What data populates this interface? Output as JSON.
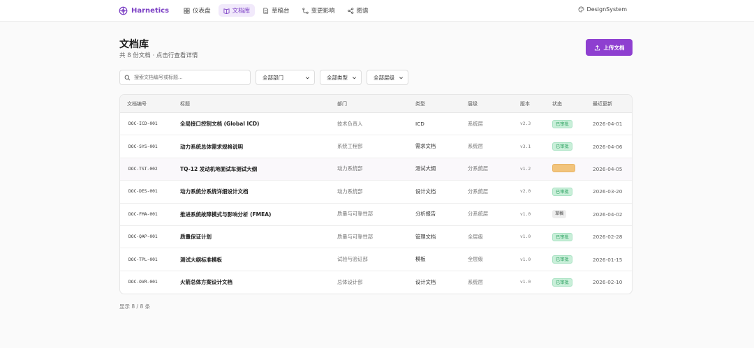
{
  "brand": {
    "name": "Harnetics"
  },
  "nav": [
    {
      "label": "仪表盘",
      "icon": "dashboard-icon",
      "active": false
    },
    {
      "label": "文档库",
      "icon": "book-icon",
      "active": true
    },
    {
      "label": "草稿台",
      "icon": "draft-icon",
      "active": false
    },
    {
      "label": "变更影响",
      "icon": "impact-icon",
      "active": false
    },
    {
      "label": "图谱",
      "icon": "graph-icon",
      "active": false
    }
  ],
  "design_system": {
    "label": "DesignSystem"
  },
  "page": {
    "title": "文档库",
    "subtitle": "共 8 份文档 · 点击行查看详情",
    "upload_label": "上传文档"
  },
  "filters": {
    "search_placeholder": "搜索文档编号或标题...",
    "department": "全部部门",
    "type": "全部类型",
    "level": "全部层级"
  },
  "table": {
    "headers": [
      "文档编号",
      "标题",
      "部门",
      "类型",
      "层级",
      "版本",
      "状态",
      "最近更新"
    ],
    "rows": [
      {
        "id": "DOC-ICD-001",
        "title": "全局接口控制文档 (Global ICD)",
        "dept": "技术负责人",
        "type": "ICD",
        "level": "系统层",
        "version": "v2.3",
        "status": "已审批",
        "status_kind": "green",
        "updated": "2026-04-01"
      },
      {
        "id": "DOC-SYS-001",
        "title": "动力系统总体需求规格说明",
        "dept": "系统工程部",
        "type": "需求文档",
        "level": "系统层",
        "version": "v3.1",
        "status": "已审批",
        "status_kind": "green",
        "updated": "2026-04-06"
      },
      {
        "id": "DOC-TST-002",
        "title": "TQ-12 发动机地面试车测试大纲",
        "dept": "动力系统部",
        "type": "测试大纲",
        "level": "分系统层",
        "version": "v1.2",
        "status": "",
        "status_kind": "orange",
        "updated": "2026-04-05"
      },
      {
        "id": "DOC-DES-001",
        "title": "动力系统分系统详细设计文档",
        "dept": "动力系统部",
        "type": "设计文档",
        "level": "分系统层",
        "version": "v2.0",
        "status": "已审批",
        "status_kind": "green",
        "updated": "2026-03-20"
      },
      {
        "id": "DOC-FMA-001",
        "title": "推进系统故障模式与影响分析 (FMEA)",
        "dept": "质量与可靠性部",
        "type": "分析报告",
        "level": "分系统层",
        "version": "v1.0",
        "status": "草稿",
        "status_kind": "gray",
        "updated": "2026-04-02"
      },
      {
        "id": "DOC-QAP-001",
        "title": "质量保证计划",
        "dept": "质量与可靠性部",
        "type": "管理文档",
        "level": "全层级",
        "version": "v1.0",
        "status": "已审批",
        "status_kind": "green",
        "updated": "2026-02-28"
      },
      {
        "id": "DOC-TPL-001",
        "title": "测试大纲标准模板",
        "dept": "试验与验证部",
        "type": "模板",
        "level": "全层级",
        "version": "v1.0",
        "status": "已审批",
        "status_kind": "green",
        "updated": "2026-01-15"
      },
      {
        "id": "DOC-OVR-001",
        "title": "火箭总体方案设计文档",
        "dept": "总体设计部",
        "type": "设计文档",
        "level": "系统层",
        "version": "v1.0",
        "status": "已审批",
        "status_kind": "green",
        "updated": "2026-02-10"
      }
    ]
  },
  "footer": {
    "count_text": "显示 8 / 8 条"
  },
  "colors": {
    "accent": "#8e3fd0",
    "approved": "#2aa05f",
    "pending": "#f2c47c"
  }
}
